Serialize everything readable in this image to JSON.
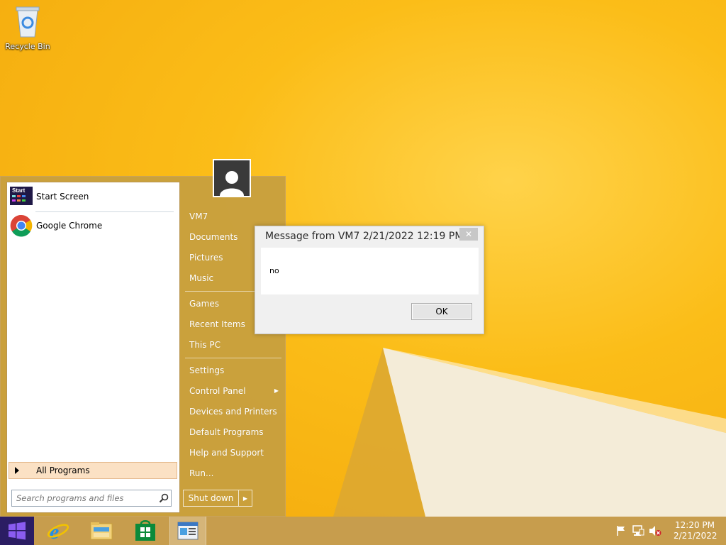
{
  "desktop": {
    "recycle_bin_label": "Recycle Bin"
  },
  "start_menu": {
    "pinned": [
      {
        "label": "Start Screen",
        "icon": "start-screen-icon",
        "icon_text": "Start"
      },
      {
        "label": "Google Chrome",
        "icon": "chrome-icon"
      }
    ],
    "all_programs_label": "All Programs",
    "search_placeholder": "Search programs and files",
    "right_items": [
      {
        "label": "VM7"
      },
      {
        "label": "Documents"
      },
      {
        "label": "Pictures"
      },
      {
        "label": "Music"
      },
      {
        "label": "Games"
      },
      {
        "label": "Recent Items"
      },
      {
        "label": "This PC"
      },
      {
        "label": "Settings"
      },
      {
        "label": "Control Panel",
        "has_submenu": true
      },
      {
        "label": "Devices and Printers"
      },
      {
        "label": "Default Programs"
      },
      {
        "label": "Help and Support"
      },
      {
        "label": "Run..."
      }
    ],
    "shutdown_label": "Shut down"
  },
  "dialog": {
    "title": "Message from VM7 2/21/2022 12:19 PM",
    "close_glyph": "✕",
    "message": "no",
    "ok_label": "OK"
  },
  "taskbar": {
    "apps": [
      {
        "name": "internet-explorer",
        "icon": "ie-icon"
      },
      {
        "name": "file-explorer",
        "icon": "folder-icon"
      },
      {
        "name": "store",
        "icon": "store-icon"
      },
      {
        "name": "message-window",
        "icon": "message-app-icon",
        "active": true
      }
    ],
    "tray_icons": [
      "flag-icon",
      "network-icon",
      "volume-muted-icon"
    ],
    "time": "12:20 PM",
    "date": "2/21/2022"
  },
  "colors": {
    "accent": "#2b1d63",
    "desktop": "#f5b312",
    "start_menu": "#c69e40"
  }
}
